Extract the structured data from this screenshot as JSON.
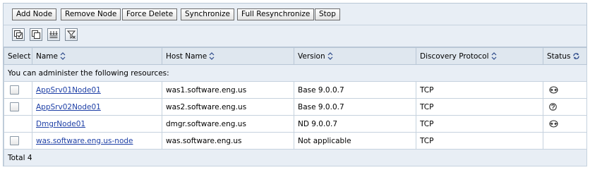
{
  "toolbar": {
    "add_node": "Add Node",
    "remove_node": "Remove Node",
    "force_delete": "Force Delete",
    "synchronize": "Synchronize",
    "full_resynchronize": "Full Resynchronize",
    "stop": "Stop"
  },
  "icon_toolbar": [
    "select-all-icon",
    "deselect-all-icon",
    "show-filter-icon",
    "clear-filter-icon"
  ],
  "table": {
    "headers": {
      "select": "Select",
      "name": "Name",
      "host": "Host Name",
      "version": "Version",
      "protocol": "Discovery Protocol",
      "status": "Status"
    },
    "message": "You can administer the following resources:",
    "rows": [
      {
        "name": "AppSrv01Node01",
        "host": "was1.software.eng.us",
        "version": "Base 9.0.0.7",
        "protocol": "TCP",
        "status": "synchronized",
        "checkbox": true
      },
      {
        "name": "AppSrv02Node01",
        "host": "was2.software.eng.us",
        "version": "Base 9.0.0.7",
        "protocol": "TCP",
        "status": "unknown",
        "checkbox": true
      },
      {
        "name": "DmgrNode01",
        "host": "dmgr.software.eng.us",
        "version": "ND 9.0.0.7",
        "protocol": "TCP",
        "status": "synchronized",
        "checkbox": false
      },
      {
        "name": "was.software.eng.us-node",
        "host": "was.software.eng.us",
        "version": "Not applicable",
        "protocol": "TCP",
        "status": "",
        "checkbox": true
      }
    ],
    "total": "Total 4"
  },
  "colors": {
    "link": "#1d3fa6",
    "toolbar_bg": "#e8eef5",
    "header_bg": "#dfe7ef",
    "border": "#b9c7d6"
  }
}
